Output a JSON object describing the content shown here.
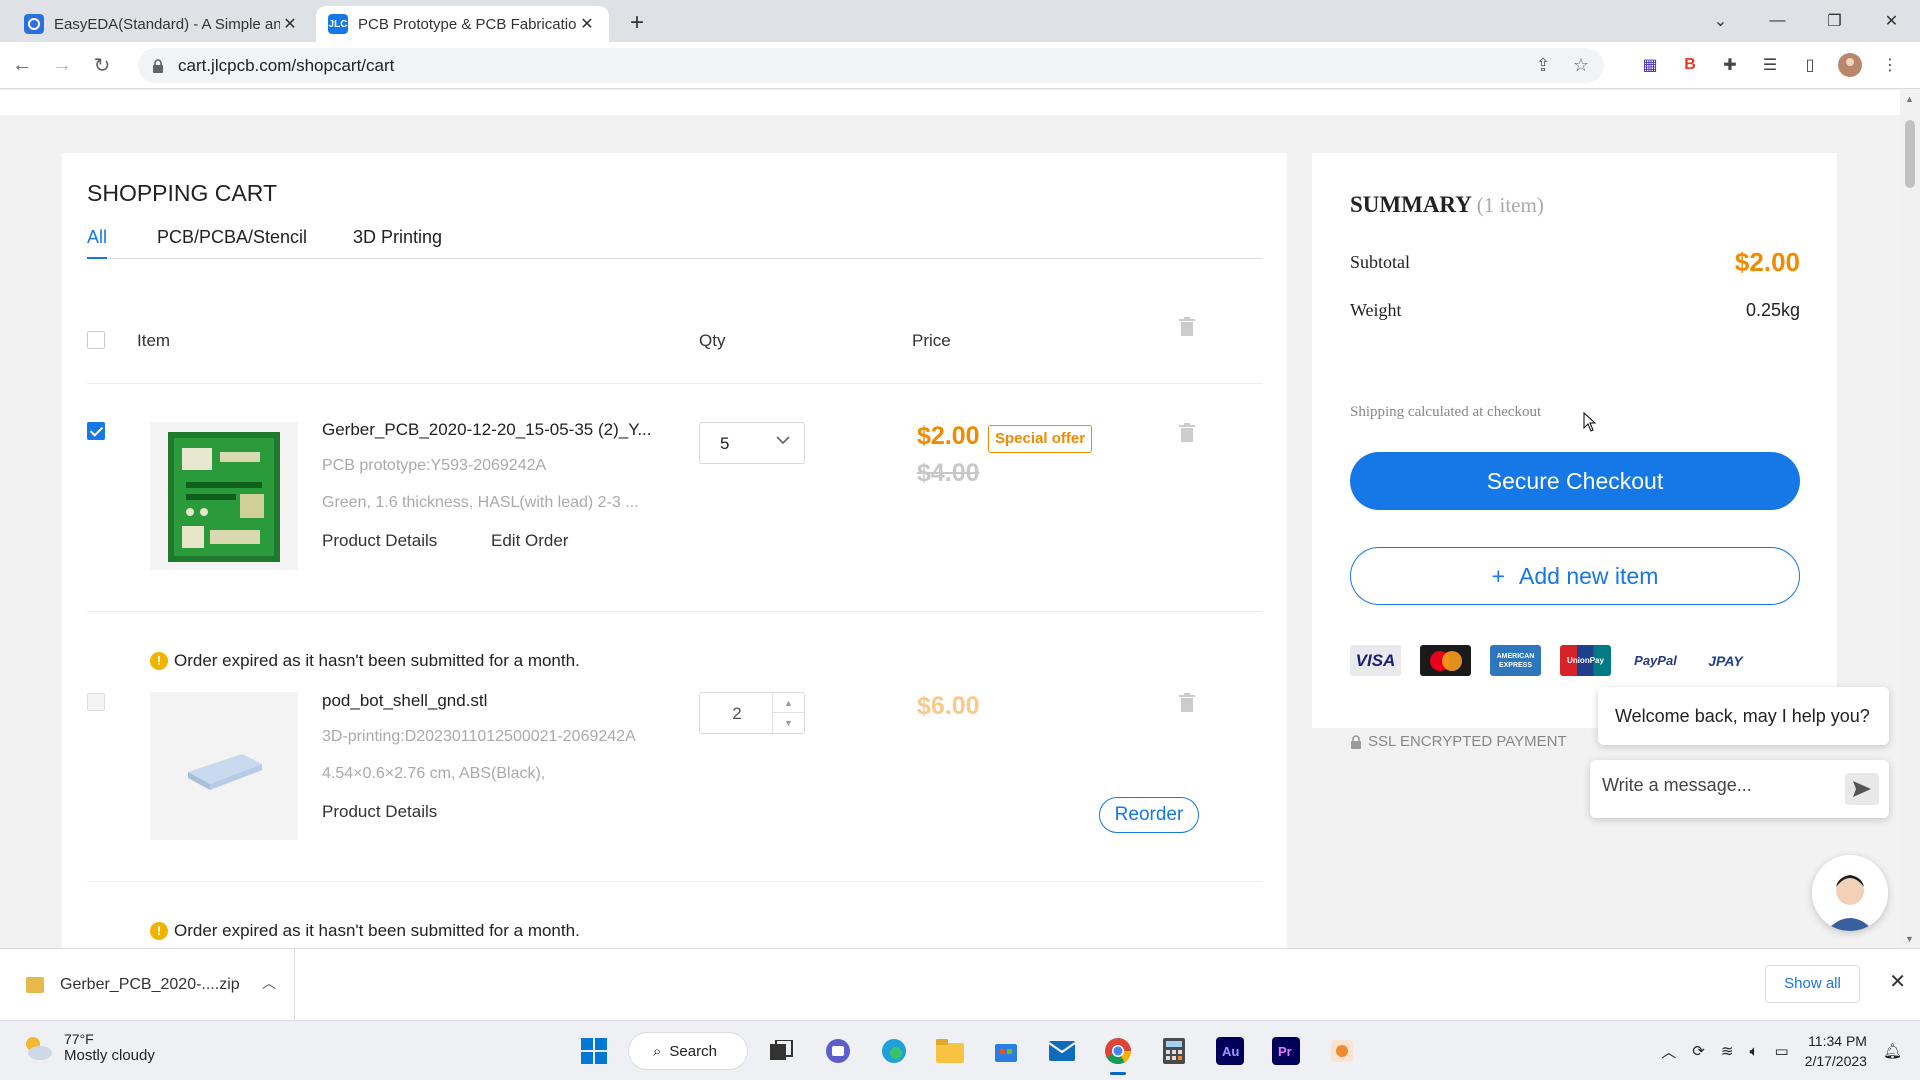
{
  "browser": {
    "tabs": [
      {
        "title": "EasyEDA(Standard) - A Simple and",
        "favicon": "easyeda-icon",
        "active": false
      },
      {
        "title": "PCB Prototype & PCB Fabrication",
        "favicon": "JLC",
        "active": true
      }
    ],
    "url": "cart.jlcpcb.com/shopcart/cart"
  },
  "cart": {
    "title": "SHOPPING CART",
    "tabs": [
      "All",
      "PCB/PCBA/Stencil",
      "3D Printing"
    ],
    "selected_tab": "All",
    "headers": {
      "item": "Item",
      "qty": "Qty",
      "price": "Price"
    },
    "items": [
      {
        "checked": true,
        "name": "Gerber_PCB_2020-12-20_15-05-35 (2)_Y...",
        "line1": "PCB prototype:Y593-2069242A",
        "line2": "Green, 1.6 thickness, HASL(with lead) 2-3 ...",
        "link1": "Product Details",
        "link2": "Edit Order",
        "qty": "5",
        "price": "$2.00",
        "badge": "Special offer",
        "old_price": "$4.00"
      },
      {
        "checked": false,
        "expired_msg": "Order expired as it hasn't been submitted for a month.",
        "name": "pod_bot_shell_gnd.stl",
        "line1": "3D-printing:D2023011012500021-2069242A",
        "line2": "4.54×0.6×2.76 cm, ABS(Black),",
        "link1": "Product Details",
        "qty": "2",
        "price": "$6.00",
        "action": "Reorder"
      }
    ],
    "third_expired_msg": "Order expired as it hasn't been submitted for a month."
  },
  "summary": {
    "title": "SUMMARY",
    "count": "(1 item)",
    "subtotal_label": "Subtotal",
    "subtotal": "$2.00",
    "weight_label": "Weight",
    "weight": "0.25kg",
    "shipping_note": "Shipping calculated at checkout",
    "checkout": "Secure Checkout",
    "add_item": "Add new item",
    "add_item_plus": "+",
    "payments": [
      "VISA",
      "MasterCard",
      "AMERICAN EXPRESS",
      "UnionPay",
      "PayPal",
      "JPAY"
    ],
    "ssl": "SSL ENCRYPTED PAYMENT"
  },
  "chat": {
    "welcome": "Welcome back, may I help you?",
    "placeholder": "Write a message..."
  },
  "downloads": {
    "file": "Gerber_PCB_2020-....zip",
    "show_all": "Show all"
  },
  "taskbar": {
    "temp": "77°F",
    "weather": "Mostly cloudy",
    "search": "Search",
    "time": "11:34 PM",
    "date": "2/17/2023"
  },
  "colors": {
    "accent": "#1677e6",
    "price": "#f08a00"
  }
}
